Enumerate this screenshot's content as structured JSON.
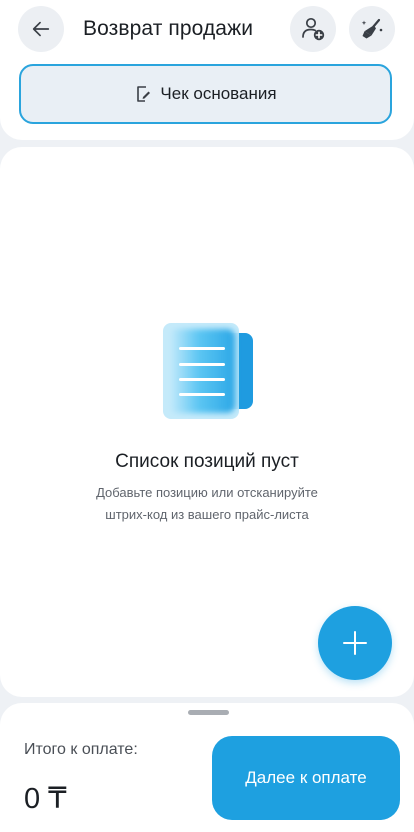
{
  "header": {
    "title": "Возврат продажи",
    "back_icon": "arrow-left-icon",
    "customer_icon": "add-customer-icon",
    "clear_icon": "broom-icon"
  },
  "receipt": {
    "label": "Чек основания",
    "icon": "edit-document-icon"
  },
  "empty_state": {
    "title": "Список позиций пуст",
    "subtitle_line1": "Добавьте позицию или отсканируйте",
    "subtitle_line2": "штрих-код из вашего прайс-листа",
    "icon": "document-list-icon"
  },
  "fab": {
    "icon": "plus-icon"
  },
  "footer": {
    "total_label": "Итого к оплате:",
    "total_amount": "0 ₸",
    "pay_label": "Далее к оплате"
  },
  "colors": {
    "accent": "#1ea0e0",
    "receipt_border": "#2aa4dd",
    "background": "#eef1f5"
  }
}
